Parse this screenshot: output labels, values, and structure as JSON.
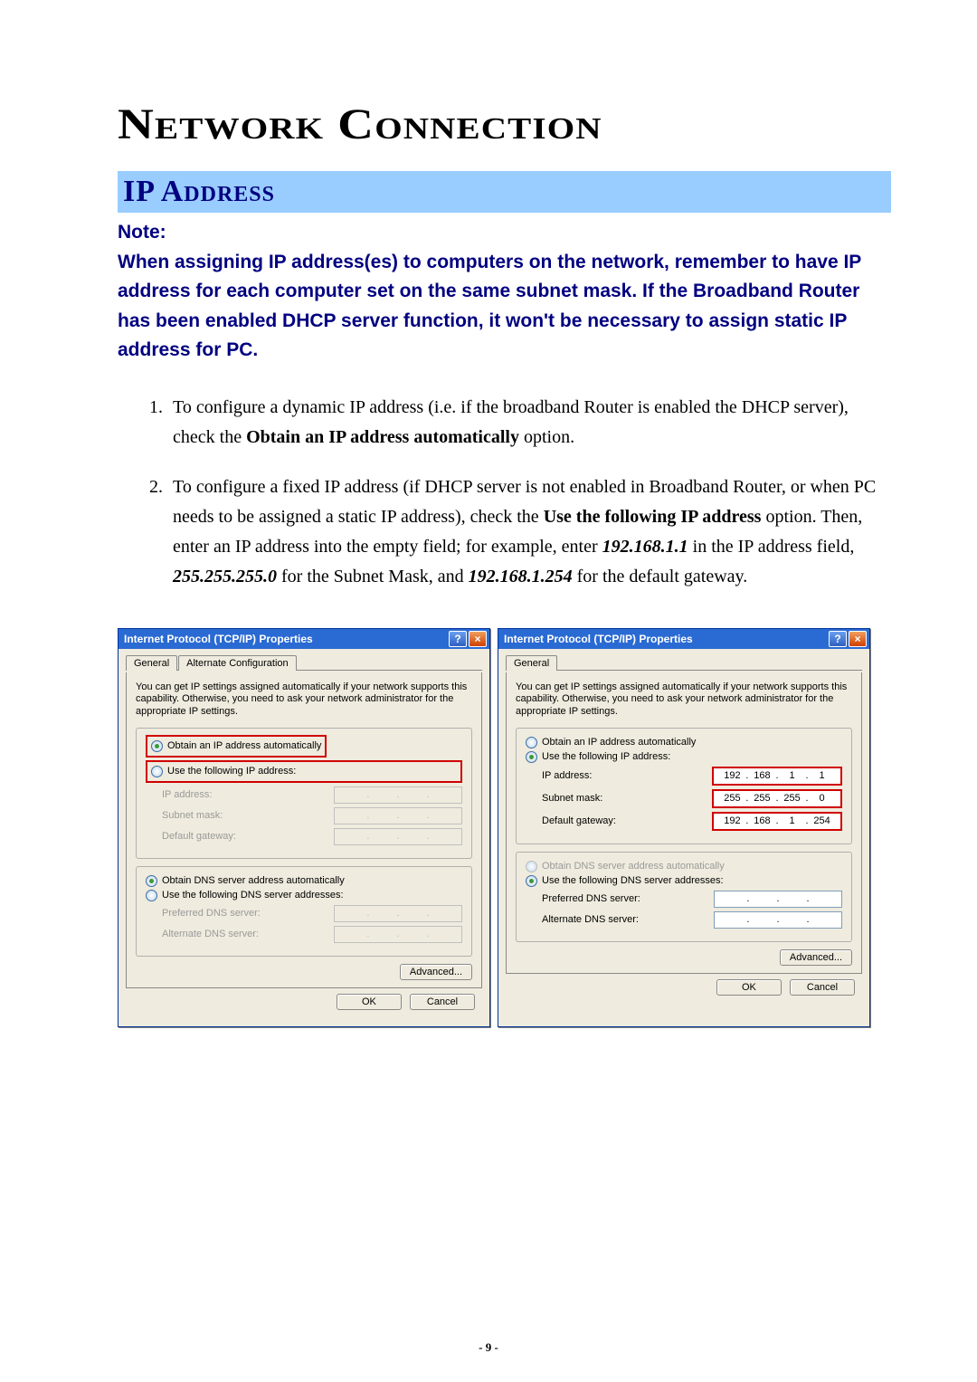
{
  "title": "Network Connection",
  "section_header": "IP Address",
  "note_label": "Note:",
  "note_body": "When assigning IP address(es) to computers on the network, remember to have IP address for each computer set on the same subnet mask. If the Broadband Router has been enabled DHCP server function, it won't be necessary to assign static IP address for PC.",
  "steps": {
    "s1_a": "To configure a dynamic IP address (i.e. if the broadband Router is enabled the DHCP server), check the ",
    "s1_b": "Obtain an IP address automatically",
    "s1_c": " option.",
    "s2_a": "To configure a fixed IP address (if DHCP server is not enabled in Broadband Router, or when PC needs to be assigned a static IP address), check the ",
    "s2_b": "Use the following IP address",
    "s2_c": " option. Then, enter an IP address into the empty field; for example, enter ",
    "s2_d": "192.168.1.1",
    "s2_e": " in the IP address field, ",
    "s2_f": "255.255.255.0",
    "s2_g": " for the Subnet Mask, and ",
    "s2_h": "192.168.1.254",
    "s2_i": " for the default gateway."
  },
  "dialog": {
    "title": "Internet Protocol (TCP/IP) Properties",
    "tab_general": "General",
    "tab_alt": "Alternate Configuration",
    "desc": "You can get IP settings assigned automatically if your network supports this capability. Otherwise, you need to ask your network administrator for the appropriate IP settings.",
    "r_obtain_ip": "Obtain an IP address automatically",
    "r_use_ip": "Use the following IP address:",
    "lbl_ip": "IP address:",
    "lbl_mask": "Subnet mask:",
    "lbl_gw": "Default gateway:",
    "r_obtain_dns": "Obtain DNS server address automatically",
    "r_use_dns": "Use the following DNS server addresses:",
    "lbl_pdns": "Preferred DNS server:",
    "lbl_adns": "Alternate DNS server:",
    "btn_adv": "Advanced...",
    "btn_ok": "OK",
    "btn_cancel": "Cancel"
  },
  "right_values": {
    "ip": [
      "192",
      "168",
      "1",
      "1"
    ],
    "mask": [
      "255",
      "255",
      "255",
      "0"
    ],
    "gw": [
      "192",
      "168",
      "1",
      "254"
    ]
  },
  "page_number": "- 9 -"
}
